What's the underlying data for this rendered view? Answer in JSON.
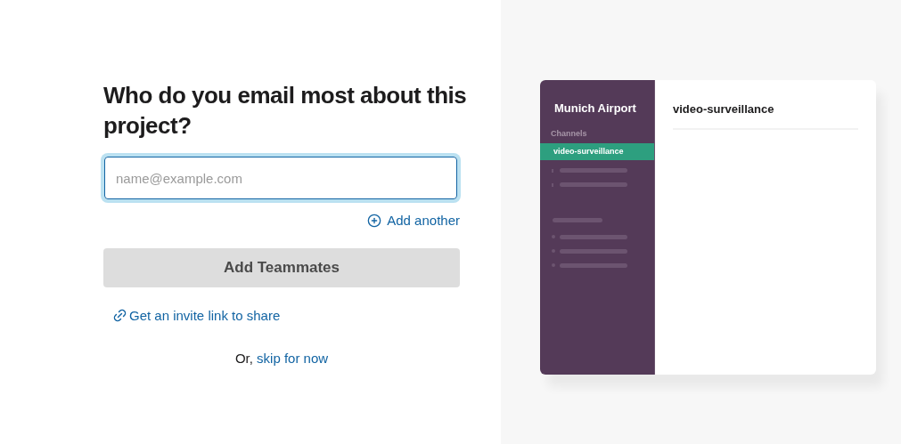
{
  "form": {
    "heading": "Who do you email most about this project?",
    "email_field": {
      "placeholder": "name@example.com"
    },
    "add_another": "Add another",
    "submit_button": {
      "label": "Add Teammates",
      "disabled": true
    },
    "invite_link": "Get an invite link to share",
    "skip_prefix": "Or,",
    "skip_link": "skip for now"
  },
  "preview": {
    "workspace_name": "Munich Airport",
    "section_label": "Channels",
    "channels": [
      {
        "name": "video-surveillance",
        "selected": true
      }
    ],
    "channel_title": "video-surveillance"
  }
}
